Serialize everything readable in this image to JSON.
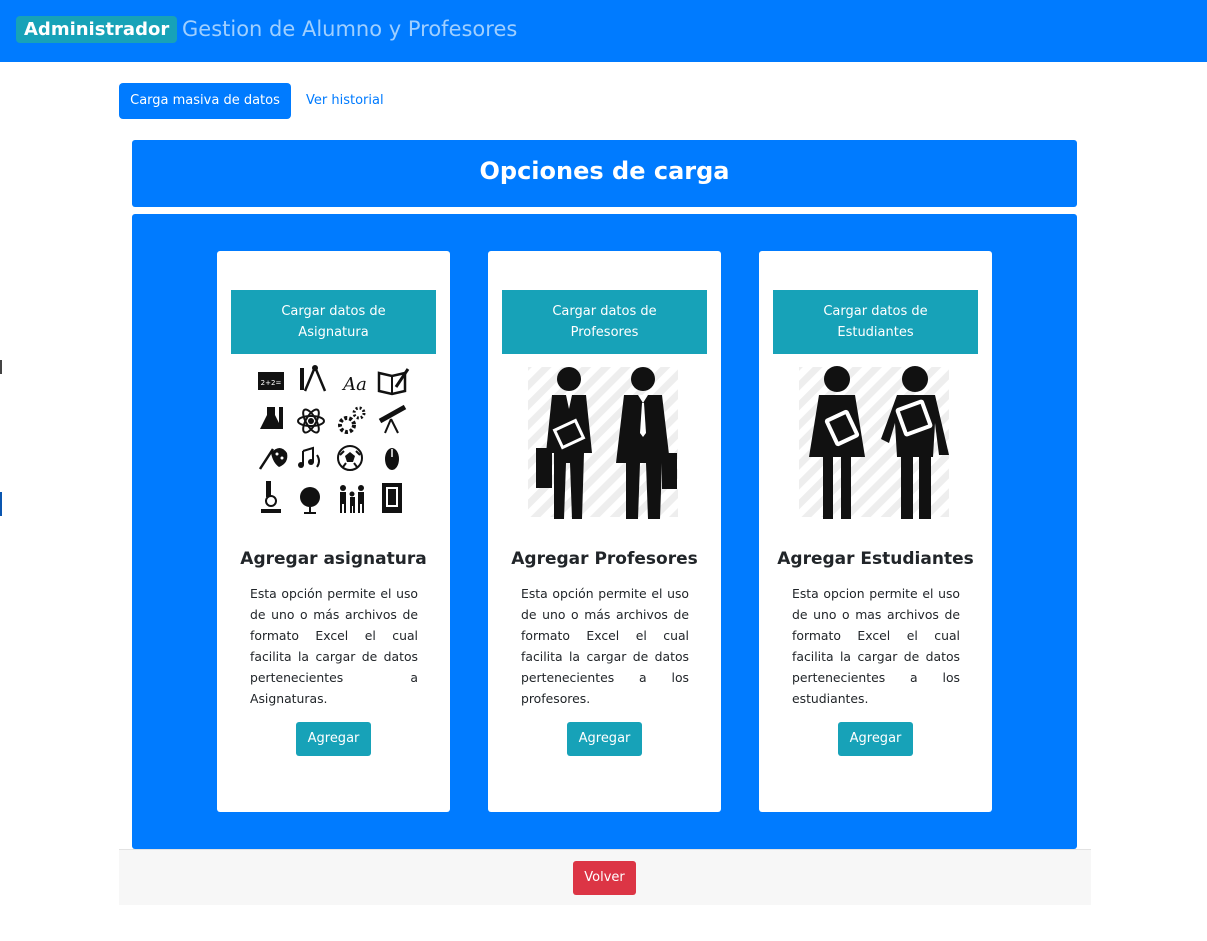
{
  "navbar": {
    "brand": "Administrador",
    "title": "Gestion de Alumno y Profesores"
  },
  "tabs": {
    "active": "Carga masiva de datos",
    "link": "Ver historial"
  },
  "panel": {
    "title": "Opciones de carga"
  },
  "cards": [
    {
      "header_line1": "Cargar datos de",
      "header_line2": "Asignatura",
      "icon": "school-subjects-icon-grid",
      "title": "Agregar asignatura",
      "text": "Esta opción permite el uso de uno o más archivos de formato Excel el cual facilita la cargar de datos pertenecientes a Asignaturas.",
      "button": "Agregar"
    },
    {
      "header_line1": "Cargar datos de",
      "header_line2": "Profesores",
      "icon": "teachers-pictogram",
      "title": "Agregar Profesores",
      "text": "Esta opción permite el uso de uno o más archivos de formato Excel el cual facilita la cargar de datos pertenecientes a los profesores.",
      "button": "Agregar"
    },
    {
      "header_line1": "Cargar datos de",
      "header_line2": "Estudiantes",
      "icon": "students-pictogram",
      "title": "Agregar Estudiantes",
      "text": "Esta opcion permite el uso de uno o mas archivos de formato Excel el cual facilita la cargar de datos pertenecientes a los estudiantes.",
      "button": "Agregar"
    }
  ],
  "footer": {
    "back_label": "Volver"
  },
  "colors": {
    "primary": "#007bff",
    "info": "#17a2b8",
    "danger": "#dc3545"
  }
}
